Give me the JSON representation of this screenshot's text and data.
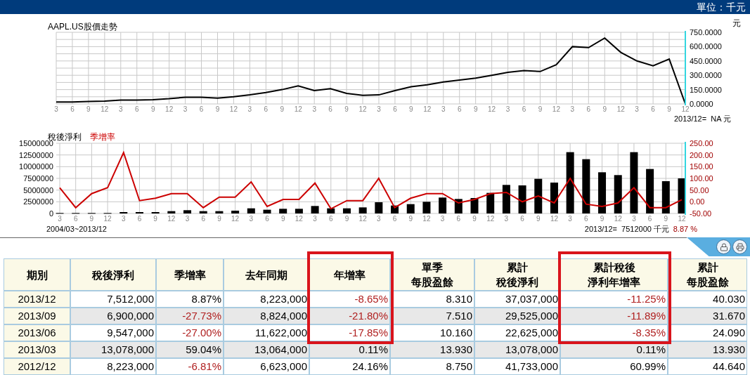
{
  "header": {
    "unit": "單位：千元"
  },
  "price_chart": {
    "chart_data": {
      "type": "line",
      "title": "AAPL.US股價走勢",
      "ylabel": "元",
      "grid": true,
      "categories": [
        "3",
        "6",
        "9",
        "12",
        "3",
        "6",
        "9",
        "12",
        "3",
        "6",
        "9",
        "12",
        "3",
        "6",
        "9",
        "12",
        "3",
        "6",
        "9",
        "12",
        "3",
        "6",
        "9",
        "12",
        "3",
        "6",
        "9",
        "12",
        "3",
        "6",
        "9",
        "12",
        "3",
        "6",
        "9",
        "12",
        "3",
        "6",
        "9",
        "12"
      ],
      "series": [
        {
          "color": "#000000",
          "values": [
            20,
            20,
            25,
            30,
            40,
            40,
            45,
            55,
            70,
            70,
            60,
            75,
            95,
            120,
            150,
            190,
            140,
            160,
            110,
            90,
            95,
            140,
            180,
            200,
            230,
            250,
            270,
            300,
            330,
            350,
            340,
            410,
            600,
            590,
            690,
            540,
            450,
            400,
            470,
            0
          ]
        }
      ],
      "ylim": [
        0,
        750
      ],
      "yticks": [
        {
          "value": 0,
          "label": "0.0000"
        },
        {
          "value": 150,
          "label": "150.0000"
        },
        {
          "value": 300,
          "label": "300.0000"
        },
        {
          "value": 450,
          "label": "450.0000"
        },
        {
          "value": 600,
          "label": "600.0000"
        },
        {
          "value": 750,
          "label": "750.0000"
        }
      ],
      "annotations": [
        "2013/12=  NA 元"
      ]
    }
  },
  "profit_chart": {
    "chart_data": {
      "type": "bar",
      "xlabel": "2004/03~2013/12",
      "grid": true,
      "categories": [
        "3",
        "6",
        "9",
        "12",
        "3",
        "6",
        "9",
        "12",
        "3",
        "6",
        "9",
        "12",
        "3",
        "6",
        "9",
        "12",
        "3",
        "6",
        "9",
        "12",
        "3",
        "6",
        "9",
        "12",
        "3",
        "6",
        "9",
        "12",
        "3",
        "6",
        "9",
        "12",
        "3",
        "6",
        "9",
        "12",
        "3",
        "6",
        "9",
        "12"
      ],
      "series": [
        {
          "name": "稅後淨利",
          "color": "#000000",
          "values": [
            100000,
            100000,
            100000,
            100000,
            300000,
            300000,
            300000,
            500000,
            700000,
            500000,
            500000,
            600000,
            1100000,
            800000,
            1000000,
            1000000,
            1600000,
            1100000,
            1100000,
            1300000,
            2400000,
            1700000,
            2000000,
            2500000,
            3400000,
            3100000,
            3300000,
            4400000,
            6100000,
            6000000,
            7400000,
            6600000,
            13100000,
            11600000,
            8800000,
            8200000,
            13100000,
            9500000,
            6900000,
            7500000
          ]
        }
      ],
      "ylim": [
        0,
        15000000
      ],
      "yticks": [
        0,
        2500000,
        5000000,
        7500000,
        10000000,
        12500000,
        15000000
      ],
      "annotations": [
        "2013/12=  7512000 千元"
      ]
    }
  },
  "growth_chart": {
    "chart_data": {
      "type": "line",
      "series": [
        {
          "name": "季增率",
          "color": "#cc0000",
          "values": [
            60,
            -25,
            35,
            60,
            210,
            5,
            15,
            35,
            35,
            -25,
            20,
            20,
            85,
            -20,
            10,
            10,
            80,
            -30,
            5,
            5,
            100,
            -25,
            15,
            35,
            35,
            -5,
            10,
            35,
            40,
            0,
            25,
            -5,
            100,
            -10,
            -20,
            -5,
            60,
            -25,
            -25,
            9
          ]
        }
      ],
      "ylim": [
        -50,
        250
      ],
      "yticks": [
        {
          "value": -50,
          "label": "-50.00"
        },
        {
          "value": 0,
          "label": "0.00"
        },
        {
          "value": 50,
          "label": "50.00"
        },
        {
          "value": 100,
          "label": "100.00"
        },
        {
          "value": 150,
          "label": "150.00"
        },
        {
          "value": 200,
          "label": "200.00"
        },
        {
          "value": 250,
          "label": "250.00"
        }
      ],
      "annotations": [
        "8.87 %"
      ]
    }
  },
  "table": {
    "columns": [
      {
        "lines": [
          "期別"
        ],
        "highlighted": false
      },
      {
        "lines": [
          "稅後淨利"
        ],
        "highlighted": false
      },
      {
        "lines": [
          "季增率"
        ],
        "highlighted": false
      },
      {
        "lines": [
          "去年同期"
        ],
        "highlighted": false
      },
      {
        "lines": [
          "年增率"
        ],
        "highlighted": true
      },
      {
        "lines": [
          "單季",
          "每股盈餘"
        ],
        "highlighted": false
      },
      {
        "lines": [
          "累計",
          "稅後淨利"
        ],
        "highlighted": false
      },
      {
        "lines": [
          "累計稅後",
          "淨利年增率"
        ],
        "highlighted": true
      },
      {
        "lines": [
          "累計",
          "每股盈餘"
        ],
        "highlighted": false
      }
    ],
    "rows": [
      {
        "highlighted": true,
        "cells": [
          {
            "text": "2013/12",
            "negative": false
          },
          {
            "text": "7,512,000",
            "negative": false
          },
          {
            "text": "8.87%",
            "negative": false
          },
          {
            "text": "8,223,000",
            "negative": false
          },
          {
            "text": "-8.65%",
            "negative": true
          },
          {
            "text": "8.310",
            "negative": false
          },
          {
            "text": "37,037,000",
            "negative": false
          },
          {
            "text": "-11.25%",
            "negative": true
          },
          {
            "text": "40.030",
            "negative": false
          }
        ]
      },
      {
        "highlighted": true,
        "cells": [
          {
            "text": "2013/09",
            "negative": false
          },
          {
            "text": "6,900,000",
            "negative": false
          },
          {
            "text": "-27.73%",
            "negative": true
          },
          {
            "text": "8,824,000",
            "negative": false
          },
          {
            "text": "-21.80%",
            "negative": true
          },
          {
            "text": "7.510",
            "negative": false
          },
          {
            "text": "29,525,000",
            "negative": false
          },
          {
            "text": "-11.89%",
            "negative": true
          },
          {
            "text": "31.670",
            "negative": false
          }
        ]
      },
      {
        "highlighted": true,
        "cells": [
          {
            "text": "2013/06",
            "negative": false
          },
          {
            "text": "9,547,000",
            "negative": false
          },
          {
            "text": "-27.00%",
            "negative": true
          },
          {
            "text": "11,622,000",
            "negative": false
          },
          {
            "text": "-17.85%",
            "negative": true
          },
          {
            "text": "10.160",
            "negative": false
          },
          {
            "text": "22,625,000",
            "negative": false
          },
          {
            "text": "-8.35%",
            "negative": true
          },
          {
            "text": "24.090",
            "negative": false
          }
        ]
      },
      {
        "highlighted": false,
        "cells": [
          {
            "text": "2013/03",
            "negative": false
          },
          {
            "text": "13,078,000",
            "negative": false
          },
          {
            "text": "59.04%",
            "negative": false
          },
          {
            "text": "13,064,000",
            "negative": false
          },
          {
            "text": "0.11%",
            "negative": false
          },
          {
            "text": "13.930",
            "negative": false
          },
          {
            "text": "13,078,000",
            "negative": false
          },
          {
            "text": "0.11%",
            "negative": false
          },
          {
            "text": "13.930",
            "negative": false
          }
        ]
      },
      {
        "highlighted": false,
        "cells": [
          {
            "text": "2012/12",
            "negative": false
          },
          {
            "text": "8,223,000",
            "negative": false
          },
          {
            "text": "-6.81%",
            "negative": true
          },
          {
            "text": "6,623,000",
            "negative": false
          },
          {
            "text": "24.16%",
            "negative": false
          },
          {
            "text": "8.750",
            "negative": false
          },
          {
            "text": "41,733,000",
            "negative": false
          },
          {
            "text": "60.99%",
            "negative": false
          },
          {
            "text": "44.640",
            "negative": false
          }
        ]
      }
    ]
  }
}
